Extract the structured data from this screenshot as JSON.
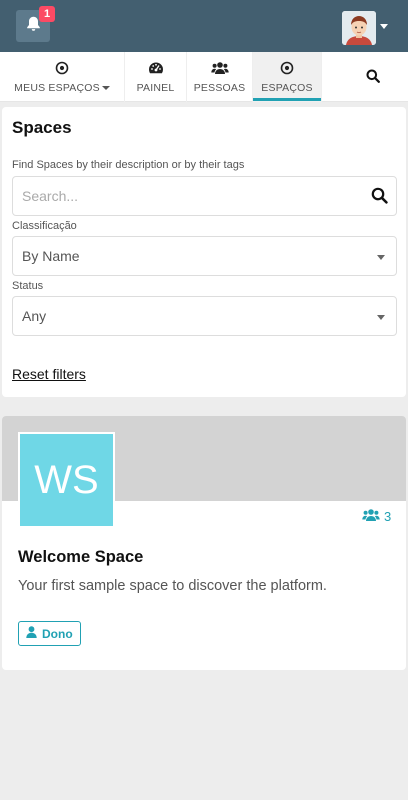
{
  "topbar": {
    "notifications_count": "1",
    "background": "#435f70"
  },
  "nav": {
    "items": [
      {
        "label": "MEUS ESPAÇOS",
        "icon": "target-icon"
      },
      {
        "label": "PAINEL",
        "icon": "dashboard-icon"
      },
      {
        "label": "PESSOAS",
        "icon": "users-icon"
      },
      {
        "label": "ESPAÇOS",
        "icon": "target-icon",
        "active": true
      }
    ],
    "search_icon": "search-icon",
    "accent": "#21a1b3"
  },
  "filters": {
    "title": "Spaces",
    "search_label": "Find Spaces by their description or by their tags",
    "search_placeholder": "Search...",
    "sort_label": "Classificação",
    "sort_value": "By Name",
    "status_label": "Status",
    "status_value": "Any",
    "reset_label": "Reset filters"
  },
  "space_card": {
    "initials": "WS",
    "initials_color": "#6fd7e6",
    "members_count": "3",
    "title": "Welcome Space",
    "description": "Your first sample space to discover the platform.",
    "role_label": "Dono"
  }
}
